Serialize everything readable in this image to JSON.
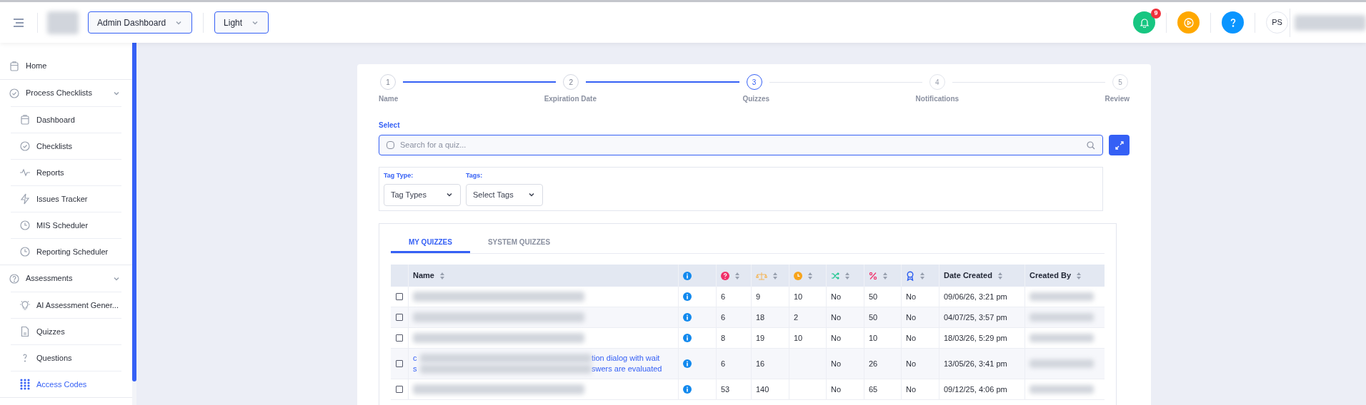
{
  "topbar": {
    "dashboard_select": "Admin Dashboard",
    "theme_select": "Light",
    "notification_count": "9",
    "avatar_initials": "PS"
  },
  "sidebar": {
    "items": [
      {
        "label": "Home",
        "selected": false
      },
      {
        "label": "Process Checklists",
        "expanded": true,
        "children": [
          {
            "label": "Dashboard",
            "selected": false
          },
          {
            "label": "Checklists",
            "selected": false
          },
          {
            "label": "Reports",
            "selected": false
          },
          {
            "label": "Issues Tracker",
            "selected": false
          },
          {
            "label": "MIS Scheduler",
            "selected": false
          },
          {
            "label": "Reporting Scheduler",
            "selected": false
          }
        ]
      },
      {
        "label": "Assessments",
        "expanded": true,
        "children": [
          {
            "label": "AI Assessment Gener...",
            "selected": false
          },
          {
            "label": "Quizzes",
            "selected": false
          },
          {
            "label": "Questions",
            "selected": false
          },
          {
            "label": "Access Codes",
            "selected": true
          }
        ]
      }
    ]
  },
  "stepper": [
    {
      "number": "1",
      "label": "Name",
      "completed": true,
      "selected": false
    },
    {
      "number": "2",
      "label": "Expiration Date",
      "completed": true,
      "selected": false
    },
    {
      "number": "3",
      "label": "Quizzes",
      "completed": false,
      "selected": true
    },
    {
      "number": "4",
      "label": "Notifications",
      "completed": false,
      "selected": false
    },
    {
      "number": "5",
      "label": "Review",
      "completed": false,
      "selected": false
    }
  ],
  "select": {
    "label": "Select",
    "placeholder": "Search for a quiz...",
    "checked": false
  },
  "filters": [
    {
      "label": "Tag Type:",
      "value": "Tag Types"
    },
    {
      "label": "Tags:",
      "value": "Select Tags"
    }
  ],
  "tabs": [
    {
      "label": "MY QUIZZES",
      "selected": true
    },
    {
      "label": "SYSTEM QUIZZES",
      "selected": false
    }
  ],
  "table": {
    "columns": [
      {
        "kind": "text",
        "label": "Name",
        "sortable": true
      },
      {
        "kind": "info",
        "sortable": false
      },
      {
        "kind": "question",
        "sortable": true
      },
      {
        "kind": "scale",
        "sortable": true
      },
      {
        "kind": "clock",
        "sortable": true
      },
      {
        "kind": "shuffle",
        "sortable": true
      },
      {
        "kind": "percent",
        "sortable": true
      },
      {
        "kind": "award",
        "sortable": true
      },
      {
        "kind": "text",
        "label": "Date Created",
        "sortable": true
      },
      {
        "kind": "text",
        "label": "Created By",
        "sortable": true
      }
    ],
    "rows": [
      {
        "checked": false,
        "cells": [
          "6",
          "9",
          "10",
          "No",
          "50",
          "No",
          "09/06/26, 3:21 pm"
        ]
      },
      {
        "checked": false,
        "cells": [
          "6",
          "18",
          "2",
          "No",
          "50",
          "No",
          "04/07/25, 3:57 pm"
        ]
      },
      {
        "checked": false,
        "cells": [
          "8",
          "19",
          "10",
          "No",
          "10",
          "No",
          "18/03/26, 5:29 pm"
        ]
      },
      {
        "checked": false,
        "name_fragments": [
          [
            "c",
            "tion dialog with wait"
          ],
          [
            "s",
            "swers are evaluated"
          ]
        ],
        "cells": [
          "6",
          "16",
          null,
          "No",
          "26",
          "No",
          "13/05/26, 3:41 pm"
        ]
      },
      {
        "checked": false,
        "cells": [
          "53",
          "140",
          null,
          "No",
          "65",
          "No",
          "09/12/25, 4:06 pm"
        ]
      }
    ]
  }
}
